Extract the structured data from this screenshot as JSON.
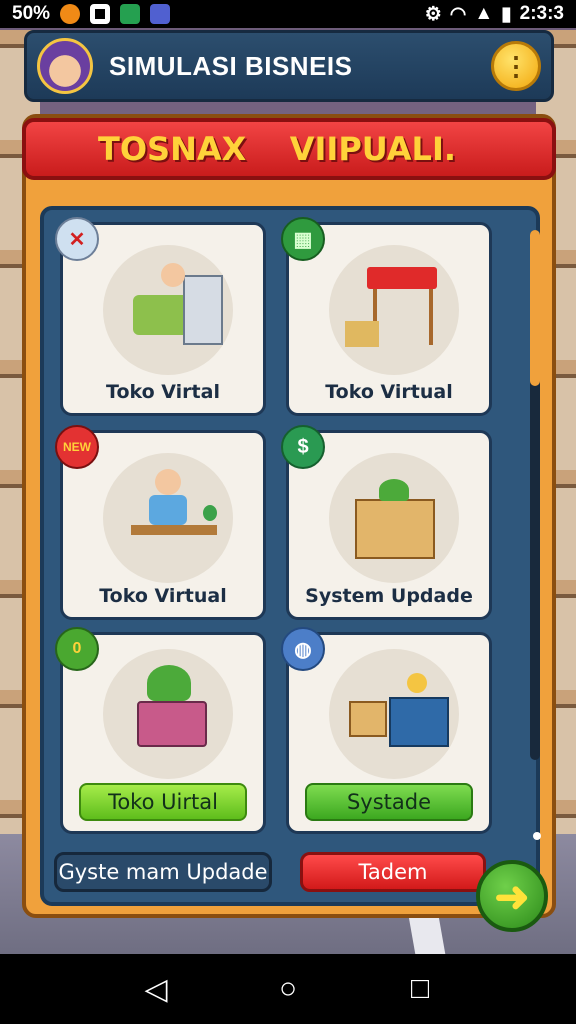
{
  "status_bar": {
    "left_text": "50%",
    "time": "2:3:3"
  },
  "header": {
    "title": "SIMULASI BISNEIS",
    "menu_icon": "more-vertical-icon",
    "avatar_icon": "avatar-icon"
  },
  "banner": {
    "left": "TOSNAX",
    "right": "VIIPUALI."
  },
  "cards": [
    {
      "label": "Toko Virtal",
      "badge_icon": "close-icon"
    },
    {
      "label": "Toko Virtual",
      "badge_icon": "grid-icon"
    },
    {
      "label": "Toko Virtual",
      "badge_icon": "tag-icon"
    },
    {
      "label": "System Updade",
      "badge_icon": "cash-icon"
    },
    {
      "button": "Toko Uirtal",
      "badge_icon": "coin-badge-icon"
    },
    {
      "button": "Systade",
      "badge_icon": "globe-icon"
    }
  ],
  "footer": {
    "left_button": "Gyste mam Updade",
    "right_button": "Tadem",
    "next_icon": "arrow-right-icon"
  },
  "nav": {
    "back_icon": "back-icon",
    "home_icon": "home-icon",
    "recents_icon": "recents-icon"
  },
  "colors": {
    "accent": "#f0a13c",
    "banner": "#e33232",
    "panel_inner": "#2f577c"
  }
}
